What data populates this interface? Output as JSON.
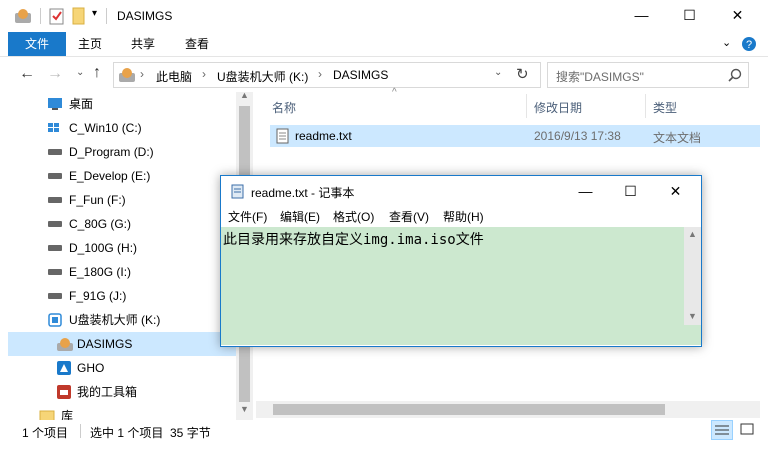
{
  "window": {
    "title": "DASIMGS",
    "minimize": "—",
    "maximize": "☐",
    "close": "✕"
  },
  "ribbon": {
    "tabs": [
      "文件",
      "主页",
      "共享",
      "查看"
    ]
  },
  "address": {
    "path": [
      "此电脑",
      "U盘装机大师 (K:)",
      "DASIMGS"
    ],
    "search_placeholder": "搜索\"DASIMGS\""
  },
  "sidebar": {
    "items": [
      {
        "label": "桌面",
        "icon": "desktop-icon"
      },
      {
        "label": "C_Win10 (C:)",
        "icon": "windows-drive-icon"
      },
      {
        "label": "D_Program (D:)",
        "icon": "drive-icon"
      },
      {
        "label": "E_Develop (E:)",
        "icon": "drive-icon"
      },
      {
        "label": "F_Fun (F:)",
        "icon": "drive-icon"
      },
      {
        "label": "C_80G (G:)",
        "icon": "drive-icon"
      },
      {
        "label": "D_100G (H:)",
        "icon": "drive-icon"
      },
      {
        "label": "E_180G (I:)",
        "icon": "drive-icon"
      },
      {
        "label": "F_91G (J:)",
        "icon": "drive-icon"
      },
      {
        "label": "U盘装机大师 (K:)",
        "icon": "usb-drive-icon"
      },
      {
        "label": "DASIMGS",
        "icon": "folder-icon"
      },
      {
        "label": "GHO",
        "icon": "folder-icon"
      },
      {
        "label": "我的工具箱",
        "icon": "folder-icon"
      },
      {
        "label": "库",
        "icon": "library-icon"
      }
    ]
  },
  "file_list": {
    "columns": [
      "名称",
      "修改日期",
      "类型"
    ],
    "rows": [
      {
        "name": "readme.txt",
        "modified": "2016/9/13 17:38",
        "type": "文本文档"
      }
    ]
  },
  "status": {
    "item_count": "1 个项目",
    "selection": "选中 1 个项目  35 字节"
  },
  "notepad": {
    "title": "readme.txt - 记事本",
    "menu": [
      "文件(F)",
      "编辑(E)",
      "格式(O)",
      "查看(V)",
      "帮助(H)"
    ],
    "content": "此目录用来存放自定义img.ima.iso文件"
  }
}
